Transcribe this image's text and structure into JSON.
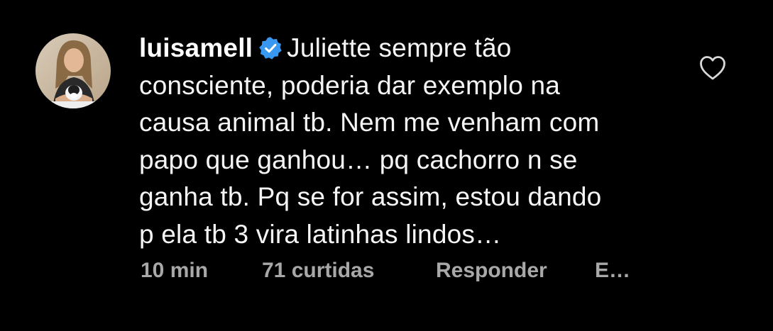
{
  "comment": {
    "username": "luisamell",
    "verified_icon": "verified-badge-icon",
    "lines": [
      "Juliette sempre tão",
      "consciente, poderia dar exemplo na",
      "causa animal tb. Nem me venham com",
      "papo que ganhou… pq cachorro n se",
      "ganha tb. Pq se for assim, estou dando",
      "p ela tb 3 vira latinhas lindos…"
    ],
    "like_icon": "heart-outline-icon"
  },
  "meta": {
    "time": "10 min",
    "likes": "71 curtidas",
    "reply": "Responder",
    "more": "E…"
  },
  "colors": {
    "background": "#000000",
    "text": "#f5f5f5",
    "secondary_text": "#a8a8a8",
    "verified_blue": "#3897f0"
  }
}
